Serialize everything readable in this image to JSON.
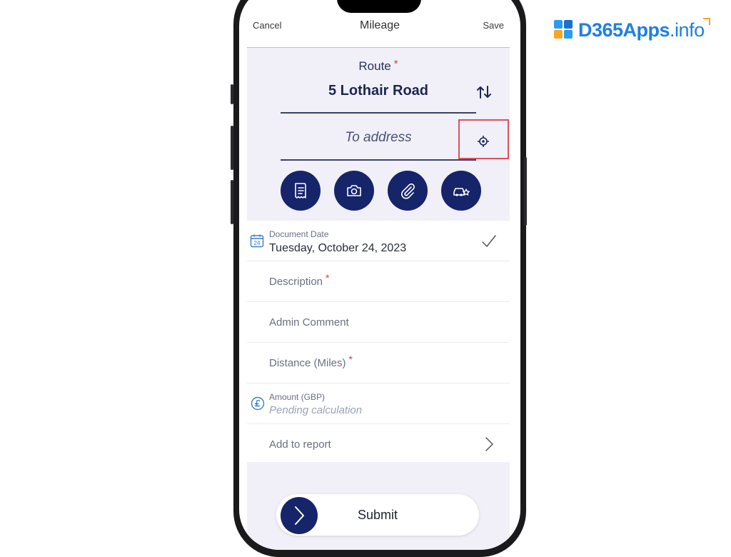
{
  "brand": {
    "name_bold": "D365Apps",
    "name_thin": ".info",
    "color": "#1f7fe0"
  },
  "nav": {
    "cancel": "Cancel",
    "title": "Mileage",
    "save": "Save"
  },
  "route": {
    "label": "Route",
    "required_mark": "*",
    "from_value": "5 Lothair Road",
    "to_placeholder": "To address"
  },
  "actions": [
    {
      "name": "receipt-icon"
    },
    {
      "name": "camera-icon"
    },
    {
      "name": "paperclip-icon"
    },
    {
      "name": "car-favorite-icon"
    }
  ],
  "form": {
    "document_date": {
      "label": "Document Date",
      "value": "Tuesday, October 24, 2023",
      "calendar_day": "24"
    },
    "description": {
      "label": "Description",
      "required_mark": "*"
    },
    "admin_comment": {
      "label": "Admin Comment"
    },
    "distance": {
      "label": "Distance (Miles)",
      "required_mark": "*"
    },
    "amount": {
      "label": "Amount (GBP)",
      "value": "Pending calculation"
    },
    "add_to_report": {
      "label": "Add to report"
    }
  },
  "submit": {
    "label": "Submit"
  },
  "colors": {
    "primary": "#16246a",
    "highlight": "#e0505a",
    "required": "#d64040",
    "panel": "#f1eff8"
  }
}
